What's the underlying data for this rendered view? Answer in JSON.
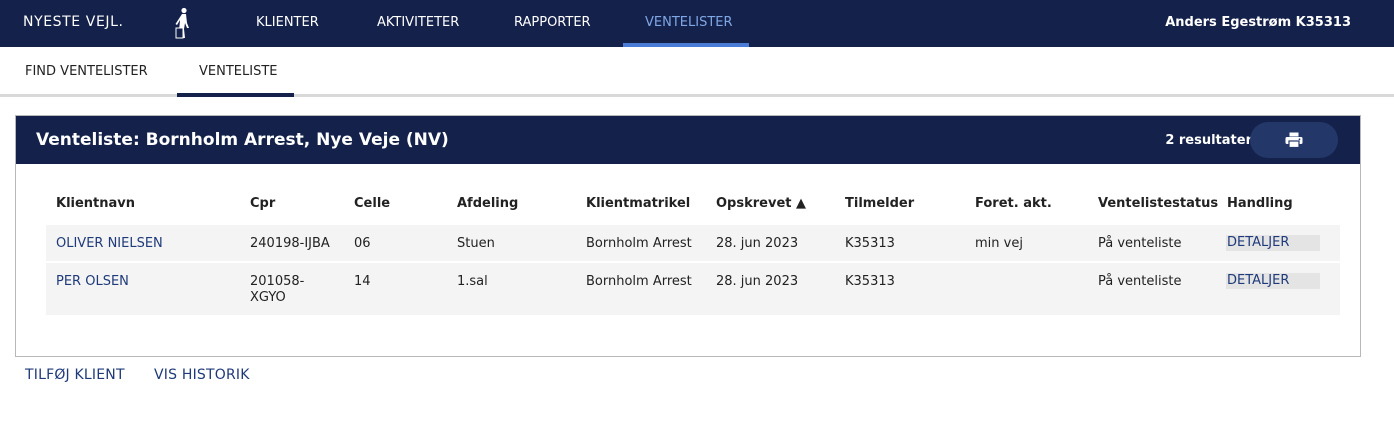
{
  "topnav": {
    "brand": "NYESTE VEJL.",
    "logo_icon": "walking-person-icon",
    "items": [
      {
        "label": "KLIENTER"
      },
      {
        "label": "AKTIVITETER"
      },
      {
        "label": "RAPPORTER"
      },
      {
        "label": "VENTELISTER",
        "active": true
      }
    ],
    "user": "Anders Egestrøm K35313",
    "active_color": "#7fa7e6",
    "background": "#14214a"
  },
  "subnav": {
    "items": [
      {
        "label": "FIND VENTELISTER"
      },
      {
        "label": "VENTELISTE",
        "active": true
      }
    ]
  },
  "panel": {
    "title": "Venteliste: Bornholm Arrest, Nye Veje (NV)",
    "result_count": "2 resultater",
    "print_icon": "printer-icon"
  },
  "table": {
    "headers": {
      "klientnavn": "Klientnavn",
      "cpr": "Cpr",
      "celle": "Celle",
      "afdeling": "Afdeling",
      "klientmatrikel": "Klientmatrikel",
      "opskrevet": "Opskrevet ▲",
      "tilmelder": "Tilmelder",
      "foret_akt": "Foret. akt.",
      "status": "Ventelistestatus",
      "handling": "Handling"
    },
    "rows": [
      {
        "klientnavn": "OLIVER NIELSEN",
        "cpr": "240198-IJBA",
        "celle": "06",
        "afdeling": "Stuen",
        "klientmatrikel": "Bornholm Arrest",
        "opskrevet": "28. jun 2023",
        "tilmelder": "K35313",
        "foret_akt": "min vej",
        "status": "På venteliste",
        "handling": "DETALJER"
      },
      {
        "klientnavn": "PER OLSEN",
        "cpr_line1": "201058-",
        "cpr_line2": "XGYO",
        "celle": "14",
        "afdeling": "1.sal",
        "klientmatrikel": "Bornholm Arrest",
        "opskrevet": "28. jun 2023",
        "tilmelder": "K35313",
        "foret_akt": "",
        "status": "På venteliste",
        "handling": "DETALJER"
      }
    ]
  },
  "actions": {
    "add_client": "TILFØJ KLIENT",
    "show_history": "VIS HISTORIK"
  }
}
